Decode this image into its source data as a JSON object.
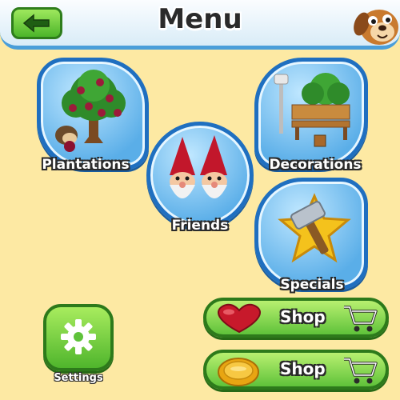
{
  "header": {
    "title": "Menu",
    "back_icon": "back-arrow-icon",
    "mascot": "dog-mascot"
  },
  "tiles": {
    "plantations": {
      "label": "Plantations",
      "icon": "fruit-tree-icon"
    },
    "friends": {
      "label": "Friends",
      "icon": "gnomes-icon"
    },
    "decorations": {
      "label": "Decorations",
      "icon": "bench-lamp-icon"
    },
    "specials": {
      "label": "Specials",
      "icon": "hammer-star-icon"
    }
  },
  "settings": {
    "label": "Settings",
    "icon": "gear-icon"
  },
  "shops": [
    {
      "label": "Shop",
      "icon": "heart-icon",
      "cart": "cart-icon"
    },
    {
      "label": "Shop",
      "icon": "coin-icon",
      "cart": "cart-icon"
    }
  ],
  "colors": {
    "background": "#fde9a3",
    "tile_blue": "#1f6fc0",
    "button_green": "#5fc23a",
    "heart_red": "#c7192b",
    "coin_gold": "#f2b31a"
  }
}
